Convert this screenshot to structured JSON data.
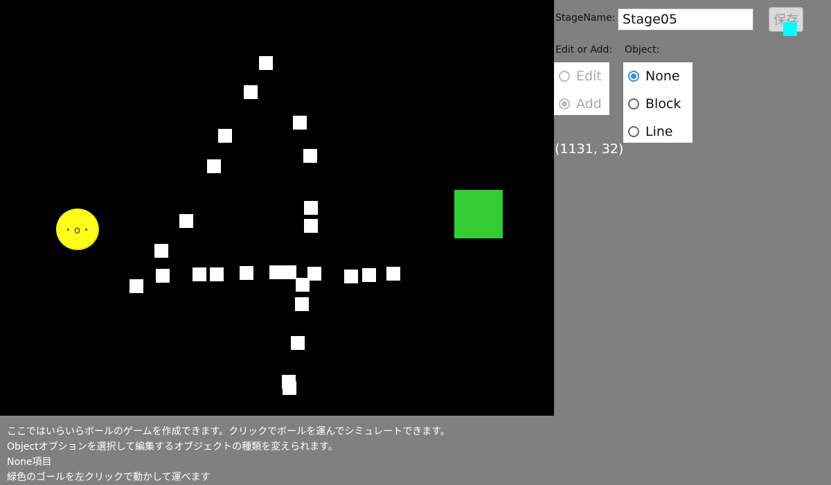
{
  "stage": {
    "ball_face": "・o・",
    "colors": {
      "background": "#000000",
      "block": "#ffffff",
      "ball": "#ffff1a",
      "goal": "#33cc33"
    }
  },
  "panel": {
    "stage_name_label": "StageName:",
    "stage_name_value": "Stage05",
    "save_label": "保存",
    "edit_or_add_label": "Edit or Add:",
    "object_label": "Object:",
    "edit_add_options": [
      {
        "label": "Edit",
        "checked": false,
        "disabled": true
      },
      {
        "label": "Add",
        "checked": true,
        "disabled": true
      }
    ],
    "object_options": [
      {
        "label": "None",
        "checked": true
      },
      {
        "label": "Block",
        "checked": false
      },
      {
        "label": "Line",
        "checked": false
      }
    ],
    "coordinates": "(1131, 32)"
  },
  "help": {
    "lines": [
      "ここではいらいらボールのゲームを作成できます。クリックでボールを運んでシミュレートできます。",
      "Objectオプションを選択して編集するオブジェクトの種類を変えられます。",
      "None項目",
      "緑色のゴールを左クリックで動かして運べます"
    ]
  }
}
